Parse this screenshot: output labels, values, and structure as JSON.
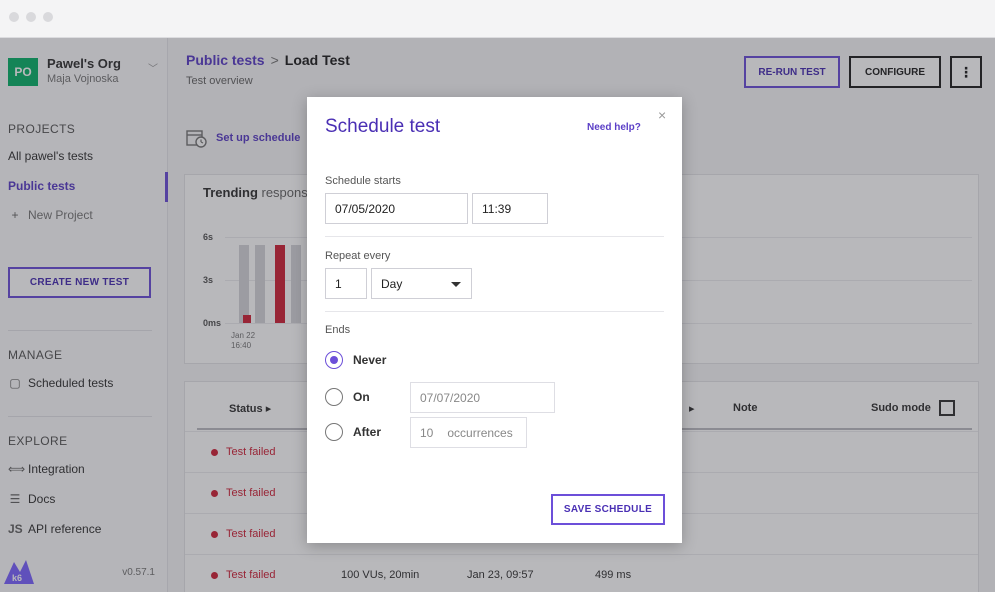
{
  "sidebar": {
    "org_initials": "PO",
    "org_name": "Pawel's Org",
    "org_user": "Maja Vojnoska",
    "projects_title": "PROJECTS",
    "projects": [
      {
        "label": "All pawel's tests"
      },
      {
        "label": "Public tests"
      }
    ],
    "new_project": "New Project",
    "create_test": "CREATE NEW TEST",
    "manage_title": "MANAGE",
    "scheduled_tests": "Scheduled tests",
    "explore_title": "EXPLORE",
    "integration": "Integration",
    "docs": "Docs",
    "api_reference": "API reference",
    "version": "v0.57.1",
    "logo_text": "k6"
  },
  "header": {
    "breadcrumb_parent": "Public tests",
    "breadcrumb_sep": ">",
    "breadcrumb_current": "Load Test",
    "subtitle": "Test overview",
    "rerun_label": "RE-RUN TEST",
    "configure_label": "CONFIGURE",
    "more_label": "⋮"
  },
  "schedule_link": "Set up schedule",
  "trending": {
    "title_bold": "Trending",
    "title_rest": " respons",
    "y_ticks": [
      "6s",
      "3s",
      "0ms"
    ],
    "x_tick_date": "Jan 22",
    "x_tick_time": "16:40"
  },
  "table": {
    "columns": {
      "status": "Status",
      "note": "Note",
      "sudo": "Sudo mode"
    },
    "rows": [
      {
        "status": "Test failed",
        "vus": "",
        "date": "",
        "resp": ""
      },
      {
        "status": "Test failed",
        "vus": "",
        "date": "",
        "resp": ""
      },
      {
        "status": "Test failed",
        "vus": "",
        "date": "",
        "resp": ""
      },
      {
        "status": "Test failed",
        "vus": "100 VUs, 20min",
        "date": "Jan 23, 09:57",
        "resp": "499 ms"
      }
    ]
  },
  "modal": {
    "title": "Schedule test",
    "help": "Need help?",
    "close": "×",
    "starts_label": "Schedule starts",
    "start_date": "07/05/2020",
    "start_time": "11:39",
    "repeat_label": "Repeat every",
    "repeat_count": "1",
    "repeat_unit": "Day",
    "ends_label": "Ends",
    "ends_options": [
      {
        "label": "Never",
        "selected": true
      },
      {
        "label": "On",
        "selected": false
      },
      {
        "label": "After",
        "selected": false
      }
    ],
    "end_date": "07/07/2020",
    "occurrences_count": "10",
    "occurrences_label": "occurrences",
    "save_label": "SAVE SCHEDULE"
  },
  "colors": {
    "accent": "#6c4fd9",
    "accent_text": "#4a2fb4",
    "failed": "#d0243a",
    "org_badge": "#0bb26a"
  }
}
